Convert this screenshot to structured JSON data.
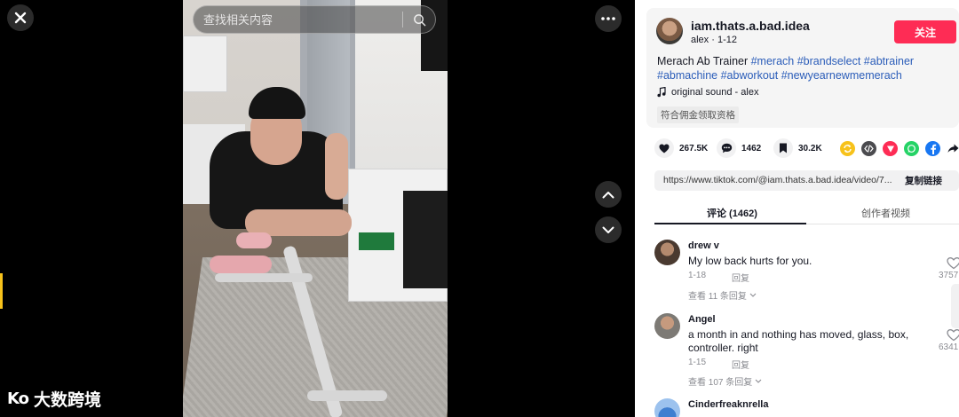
{
  "player": {
    "search_placeholder": "查找相关内容",
    "watermark_logo": "Ko",
    "watermark_text": "大数跨境"
  },
  "video_info": {
    "username": "iam.thats.a.bad.idea",
    "nickname_date": "alex · 1-12",
    "follow_label": "关注",
    "caption_text": "Merach Ab Trainer ",
    "hashtags": [
      "#merach",
      "#brandselect",
      "#abtrainer",
      "#abmachine",
      "#abworkout",
      "#newyearnewmemerach"
    ],
    "music": "original sound - alex",
    "commission_badge": "符合佣金领取资格"
  },
  "actions": {
    "likes": "267.5K",
    "comments": "1462",
    "saves": "30.2K",
    "share_icons": [
      "repost-icon",
      "embed-icon",
      "send-icon",
      "whatsapp-icon",
      "facebook-icon",
      "share-arrow-icon"
    ]
  },
  "link": {
    "url": "https://www.tiktok.com/@iam.thats.a.bad.idea/video/7...",
    "copy_label": "复制链接"
  },
  "tabs": {
    "comments": "评论 (1462)",
    "creator_videos": "创作者视频"
  },
  "comments": [
    {
      "name": "drew v",
      "text": "My low back hurts for you.",
      "date": "1-18",
      "reply": "回复",
      "likes": "3757",
      "view_replies": "查看 11 条回复"
    },
    {
      "name": "Angel",
      "text": "a month in and nothing has moved, glass, box, controller. right",
      "date": "1-15",
      "reply": "回复",
      "likes": "6341",
      "view_replies": "查看 107 条回复"
    },
    {
      "name": "Cinderfreaknrella",
      "text": "",
      "date": "",
      "reply": "",
      "likes": "",
      "view_replies": ""
    }
  ],
  "colors": {
    "follow_red": "#fe2c55",
    "hashtag_blue": "#2b5db9",
    "watermark_accent": "#f7c21b"
  }
}
